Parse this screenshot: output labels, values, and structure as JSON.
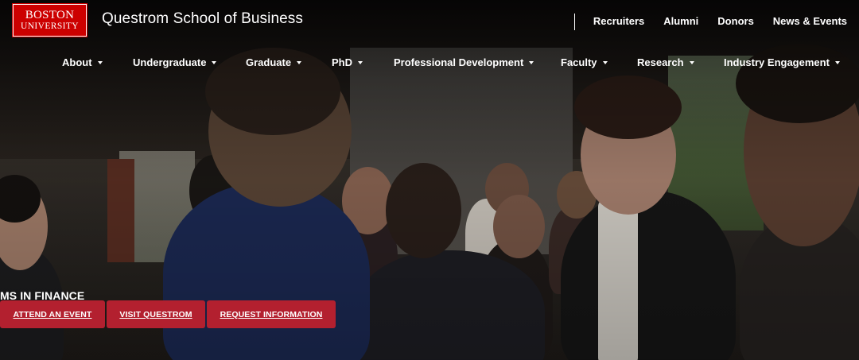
{
  "brand": {
    "logo_line1": "BOSTON",
    "logo_line2": "UNIVERSITY",
    "school_name": "Questrom School of Business",
    "accent_color": "#cc0000",
    "cta_color": "#b3202f"
  },
  "utility_nav": [
    "Recruiters",
    "Alumni",
    "Donors",
    "News & Events"
  ],
  "main_nav": [
    {
      "label": "About"
    },
    {
      "label": "Undergraduate"
    },
    {
      "label": "Graduate"
    },
    {
      "label": "PhD"
    },
    {
      "label": "Professional Development"
    },
    {
      "label": "Faculty"
    },
    {
      "label": "Research"
    },
    {
      "label": "Industry Engagement"
    }
  ],
  "hero": {
    "program_title": "MS IN FINANCE",
    "cta_buttons": [
      "ATTEND AN EVENT",
      "VISIT QUESTROM",
      "REQUEST INFORMATION"
    ]
  }
}
